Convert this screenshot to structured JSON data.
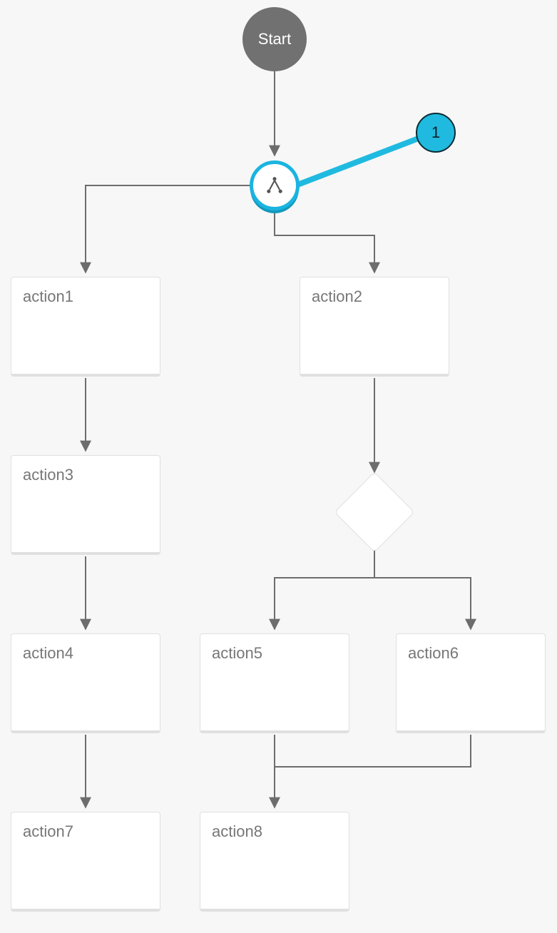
{
  "colors": {
    "start_fill": "#717171",
    "accent": "#1ab4e0",
    "accent_dark": "#1498bd",
    "box_border": "#e0e0e0",
    "edge": "#6d6d6d",
    "bg": "#f7f7f7",
    "callout_fill": "#20bae0",
    "callout_border": "#0b2b33"
  },
  "nodes": {
    "start": {
      "label": "Start"
    },
    "fork": {
      "icon": "fork-icon"
    },
    "action1": {
      "label": "action1"
    },
    "action2": {
      "label": "action2"
    },
    "action3": {
      "label": "action3"
    },
    "action4": {
      "label": "action4"
    },
    "action5": {
      "label": "action5"
    },
    "action6": {
      "label": "action6"
    },
    "action7": {
      "label": "action7"
    },
    "action8": {
      "label": "action8"
    },
    "decision": {
      "label": ""
    }
  },
  "callout": {
    "label": "1"
  },
  "flow": {
    "edges": [
      [
        "start",
        "fork"
      ],
      [
        "fork",
        "action1"
      ],
      [
        "fork",
        "action2"
      ],
      [
        "action1",
        "action3"
      ],
      [
        "action3",
        "action4"
      ],
      [
        "action4",
        "action7"
      ],
      [
        "action2",
        "decision"
      ],
      [
        "decision",
        "action5"
      ],
      [
        "decision",
        "action6"
      ],
      [
        "action5",
        "action8"
      ],
      [
        "action6",
        "action8"
      ]
    ]
  }
}
